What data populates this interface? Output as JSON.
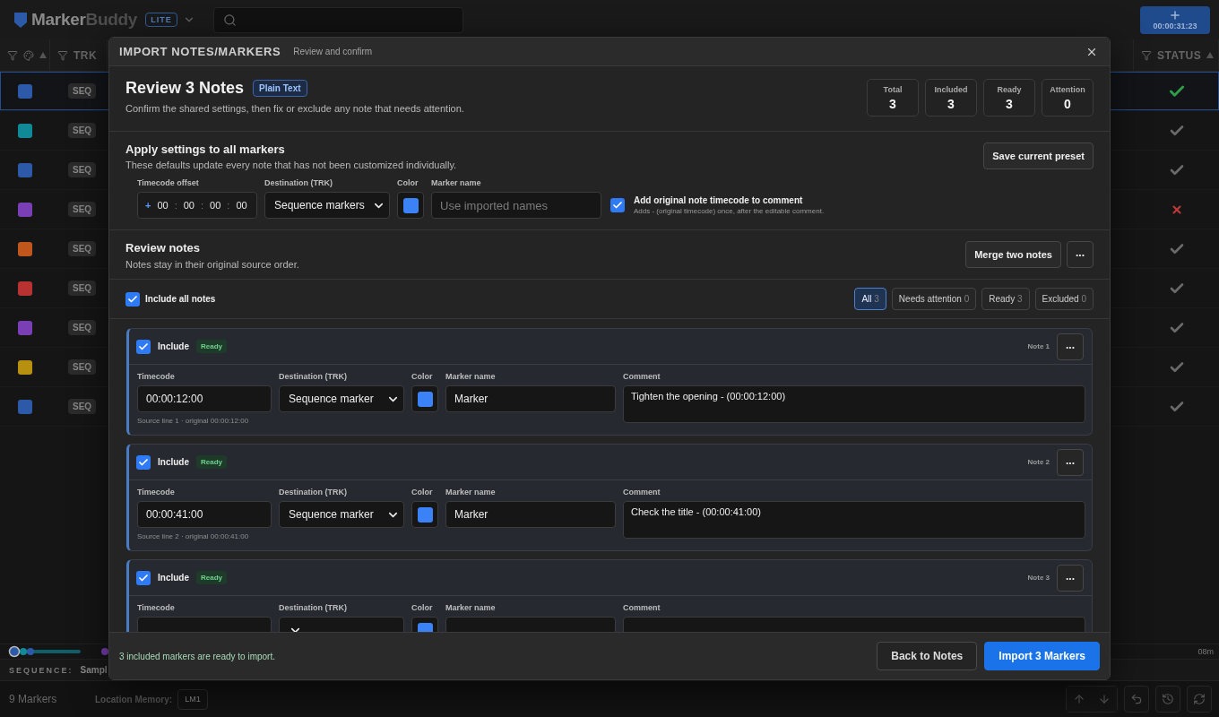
{
  "app": {
    "logo_a": "Marker",
    "logo_b": "Buddy",
    "edition": "LITE",
    "timer": "00:00:31:23"
  },
  "table": {
    "trk_heading": "TRK",
    "status_heading": "STATUS",
    "rows": [
      {
        "color": "#2d5aa8",
        "track": "SEQ",
        "kind": "verified",
        "selected": true
      },
      {
        "color": "#0f8a96",
        "track": "SEQ",
        "kind": "done",
        "selected": false
      },
      {
        "color": "#2d5aa8",
        "track": "SEQ",
        "kind": "done",
        "selected": false
      },
      {
        "color": "#7b3fb5",
        "track": "SEQ",
        "kind": "failed",
        "selected": false
      },
      {
        "color": "#c0561b",
        "track": "SEQ",
        "kind": "done",
        "selected": false
      },
      {
        "color": "#b83232",
        "track": "SEQ",
        "kind": "done",
        "selected": false
      },
      {
        "color": "#7b3fb5",
        "track": "SEQ",
        "kind": "done",
        "selected": false
      },
      {
        "color": "#b8900f",
        "track": "SEQ",
        "kind": "done",
        "selected": false
      },
      {
        "color": "#2d5aa8",
        "track": "SEQ",
        "kind": "done",
        "selected": false
      }
    ]
  },
  "timeline": {
    "end_label": "08m"
  },
  "sequence": {
    "label": "SEQUENCE:",
    "value": "Sampl"
  },
  "footer": {
    "count": "9 Markers",
    "memory_label": "Location Memory:",
    "memory_slot": "LM1"
  },
  "modal": {
    "title": "IMPORT NOTES/MARKERS",
    "subtitle": "Review and confirm",
    "summary": {
      "title": "Review 3 Notes",
      "format": "Plain Text",
      "description": "Confirm the shared settings, then fix or exclude any note that needs attention.",
      "stats": [
        {
          "label": "Total",
          "value": "3"
        },
        {
          "label": "Included",
          "value": "3"
        },
        {
          "label": "Ready",
          "value": "3"
        },
        {
          "label": "Attention",
          "value": "0"
        }
      ]
    },
    "settings": {
      "title": "Apply settings to all markers",
      "description": "These defaults update every note that has not been customized individually.",
      "preset_button": "Save current preset",
      "offset_label": "Timecode offset",
      "offset": {
        "sign": "+",
        "separator": ":",
        "parts": [
          "00",
          "00",
          "00",
          "00"
        ]
      },
      "destination_label": "Destination (TRK)",
      "destination": "Sequence markers",
      "color_label": "Color",
      "color": "#3b82f6",
      "name_label": "Marker name",
      "name_placeholder": "Use imported names",
      "append_timecode": {
        "checked": true,
        "label": "Add original note timecode to comment",
        "hint": "Adds - (original timecode) once, after the editable comment."
      }
    },
    "review": {
      "title": "Review notes",
      "description": "Notes stay in their original source order.",
      "merge_button": "Merge two notes",
      "more_button": "..."
    },
    "filters": {
      "include_all": {
        "label": "Include all notes",
        "checked": true
      },
      "chips": [
        {
          "label": "All",
          "count": "3",
          "selected": true
        },
        {
          "label": "Needs attention",
          "count": "0",
          "selected": false
        },
        {
          "label": "Ready",
          "count": "3",
          "selected": false
        },
        {
          "label": "Excluded",
          "count": "0",
          "selected": false
        }
      ]
    },
    "notes": [
      {
        "include_label": "Include",
        "included": true,
        "status": "Ready",
        "note": "Note 1",
        "menu": "...",
        "source": "Source line 1 · original 00:00:12:00",
        "fields": [
          {
            "kind": "timecode",
            "label": "Timecode",
            "value": "00:00:12:00"
          },
          {
            "kind": "select",
            "label": "Destination (TRK)",
            "value": "Sequence marker"
          },
          {
            "kind": "color",
            "label": "Color",
            "color": "#3b82f6"
          },
          {
            "kind": "text",
            "label": "Marker name",
            "value": "Marker"
          },
          {
            "kind": "comment",
            "label": "Comment",
            "value": "Tighten the opening - (00:00:12:00)"
          }
        ]
      },
      {
        "include_label": "Include",
        "included": true,
        "status": "Ready",
        "note": "Note 2",
        "menu": "...",
        "source": "Source line 2 · original 00:00:41:00",
        "fields": [
          {
            "kind": "timecode",
            "label": "Timecode",
            "value": "00:00:41:00"
          },
          {
            "kind": "select",
            "label": "Destination (TRK)",
            "value": "Sequence marker"
          },
          {
            "kind": "color",
            "label": "Color",
            "color": "#3b82f6"
          },
          {
            "kind": "text",
            "label": "Marker name",
            "value": "Marker"
          },
          {
            "kind": "comment",
            "label": "Comment",
            "value": "Check the title - (00:00:41:00)"
          }
        ]
      },
      {
        "include_label": "Include",
        "included": true,
        "status": "Ready",
        "note": "Note 3",
        "menu": "...",
        "fields": [
          {
            "kind": "timecode",
            "label": "Timecode"
          },
          {
            "kind": "select",
            "label": "Destination (TRK)"
          },
          {
            "kind": "color",
            "label": "Color",
            "color": "#3b82f6"
          },
          {
            "kind": "text",
            "label": "Marker name"
          },
          {
            "kind": "comment",
            "label": "Comment"
          }
        ]
      }
    ],
    "footer": {
      "status": "3 included markers are ready to import.",
      "back": "Back to Notes",
      "import": "Import 3 Markers"
    }
  }
}
